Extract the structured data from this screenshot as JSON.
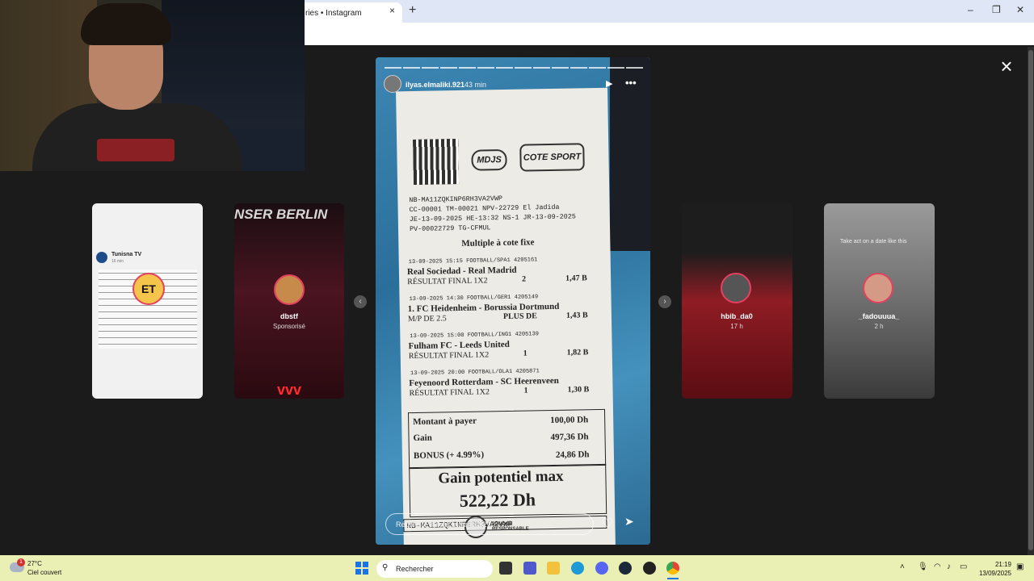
{
  "browser": {
    "tab_title": "ries • Instagram",
    "tab_close": "×",
    "new_tab": "+",
    "window": {
      "minimize": "–",
      "restore": "❐",
      "close": "✕"
    }
  },
  "story_viewer": {
    "close_label": "×",
    "main": {
      "username": "ilyas.elmaliki.921",
      "time": "43 min",
      "play": "▶",
      "more": "•••",
      "reply_placeholder": "Répondre à ilyas.elmaliki.921…",
      "like": "♡",
      "send": "➤",
      "progress_count": 14,
      "receipt": {
        "brand_left": "MDJS",
        "brand_right": "COTE SPORT",
        "ticket_lines": [
          "NB-MA11ZQKINP6RH3VA2VWP",
          "CC-00001  TM-00021         NPV-22729 El Jadida",
          "JE-13-09-2025  HE-13:32         NS-1  JR-13-09-2025",
          "PV-00022729                                   TG-CFMUL"
        ],
        "bet_type": "Multiple à cote fixe",
        "matches": [
          {
            "header": "13-09-2025 15:15   FOOTBALL/SPA1                4205161",
            "teams": "Real Sociedad - Real Madrid",
            "market": "RÉSULTAT FINAL 1X2",
            "pick": "2",
            "odds": "1,47 B"
          },
          {
            "header": "13-09-2025 14:30   FOOTBALL/GER1                4205149",
            "teams": "1. FC Heidenheim - Borussia Dortmund",
            "market": "M/P DE 2.5",
            "pick": "PLUS DE",
            "odds": "1,43 B"
          },
          {
            "header": "13-09-2025 15:00   FOOTBALL/ING1                4205139",
            "teams": "Fulham FC - Leeds United",
            "market": "RÉSULTAT FINAL 1X2",
            "pick": "1",
            "odds": "1,82 B"
          },
          {
            "header": "13-09-2025 20:00   FOOTBALL/OLA1                4205871",
            "teams": "Feyenoord Rotterdam - SC Heerenveen",
            "market": "RÉSULTAT FINAL 1X2",
            "pick": "1",
            "odds": "1,30 B"
          }
        ],
        "amount_label": "Montant à payer",
        "amount_value": "100,00 Dh",
        "gain_label": "Gain",
        "gain_value": "497,36 Dh",
        "bonus_label": "BONUS (+ 4.99%)",
        "bonus_value": "24,86 Dh",
        "potential_label": "Gain potentiel max",
        "potential_value": "522,22 Dh",
        "footer_code": "NB-MA11ZQKINP6RH3VA2VWP",
        "responsible": "JOUONS RESPONSABLE"
      }
    },
    "side_stories": [
      {
        "username": "Tunisna TV",
        "sub": "16 min",
        "badge": "ET"
      },
      {
        "username": "dbstf",
        "sub": "Sponsorisé",
        "banner": "NSER BERLIN"
      },
      {
        "username": "hbib_da0",
        "sub": "17 h"
      },
      {
        "username": "_fadouuua_",
        "sub": "2 h",
        "caption": "Take act on a date like this"
      }
    ],
    "prev_arrow": "‹",
    "next_arrow": "›"
  },
  "taskbar": {
    "weather_temp": "27°C",
    "weather_desc": "Ciel couvert",
    "weather_badge": "1",
    "search_placeholder": "Rechercher",
    "time": "21:19",
    "date": "13/09/2025"
  },
  "colors": {
    "accent": "#e4405f",
    "taskbar": "#eaf0b3",
    "story_bg": "#2c6b92"
  }
}
